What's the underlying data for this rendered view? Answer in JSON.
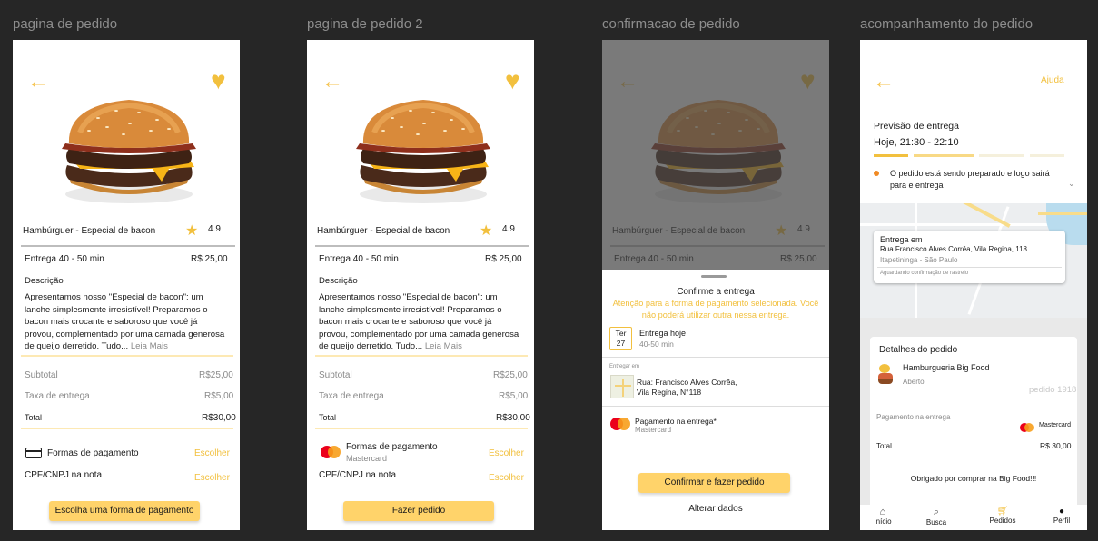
{
  "frames": [
    {
      "title": "pagina de pedido"
    },
    {
      "title": "pagina de pedido 2"
    },
    {
      "title": "confirmacao de pedido"
    },
    {
      "title": "acompanhamento do pedido"
    }
  ],
  "product": {
    "name": "Hambúrguer -  Especial de bacon",
    "rating": "4.9",
    "delivery": "Entrega 40 - 50 min",
    "price": "R$ 25,00",
    "description_title": "Descrição",
    "description": "Apresentamos nosso \"Especial de bacon\": um lanche simplesmente irresistível! Preparamos o bacon mais crocante e saboroso que você já provou, complementado por uma camada generosa de queijo derretido. Tudo...",
    "read_more": "Leia Mais"
  },
  "summary": {
    "subtotal_label": "Subtotal",
    "subtotal": "R$25,00",
    "fee_label": "Taxa de entrega",
    "fee": "R$5,00",
    "total_label": "Total",
    "total": "R$30,00"
  },
  "payment": {
    "label": "Formas de pagamento",
    "method": "Mastercard",
    "choose": "Escolher",
    "cpf_label": "CPF/CNPJ na nota"
  },
  "buttons": {
    "choose_payment": "Escolha uma forma de pagamento",
    "place_order": "Fazer pedido",
    "confirm_order": "Confirmar e fazer pedido",
    "change_data": "Alterar  dados"
  },
  "confirm": {
    "title": "Confirme a entrega",
    "warning": "Atenção para a forma de pagamento selecionada. Você não poderá utilizar outra nessa entrega.",
    "day_name": "Ter",
    "day_num": "27",
    "delivery_when": "Entrega hoje",
    "delivery_window": "40-50 min",
    "deliver_at_label": "Entregar em",
    "address_line1": "Rua: Francisco Alves Corrêa,",
    "address_line2": "Vila Regina, N°118",
    "pay_on_delivery": "Pagamento na entrega*",
    "pay_method": "Mastercard"
  },
  "tracking": {
    "help": "Ajuda",
    "forecast_label": "Previsão de entrega",
    "forecast_time": "Hoje, 21:30 - 22:10",
    "status": "O pedido está sendo preparado e logo sairá para e entrega",
    "deliver_to": "Entrega em",
    "address": "Rua Francisco Alves Corrêa, Vila Regina, 118",
    "city": "Itapetininga - São Paulo",
    "awaiting": "Aguardando confirmação de rastreio",
    "details_title": "Detalhes do pedido",
    "store": "Hamburgueria Big Food",
    "store_status": "Aberto",
    "order_no": "pedido 1918",
    "payment_label": "Pagamento na entrega",
    "payment_method": "Mastercard",
    "total_label": "Total",
    "total": "R$ 30,00",
    "thanks": "Obrigado por comprar na Big Food!!!"
  },
  "nav": [
    {
      "label": "Início",
      "icon": "home-icon"
    },
    {
      "label": "Busca",
      "icon": "search-icon"
    },
    {
      "label": "Pedidos",
      "icon": "cart-icon"
    },
    {
      "label": "Perfil",
      "icon": "user-icon"
    }
  ],
  "colors": {
    "accent": "#f2c03e",
    "button": "#ffd36a",
    "status_dot": "#f08a24"
  }
}
